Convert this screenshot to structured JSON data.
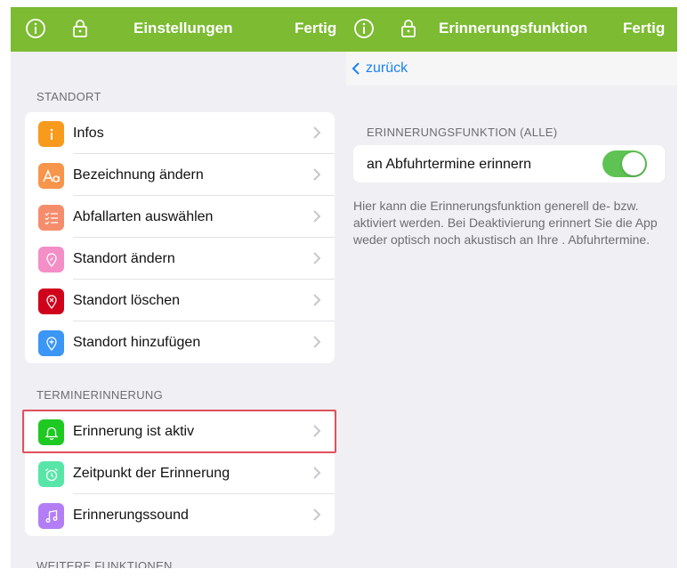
{
  "left": {
    "title": "Einstellungen",
    "done": "Fertig",
    "sections": [
      {
        "header": "STANDORT",
        "items": [
          {
            "label": "Infos",
            "icon": "info-icon",
            "color": "#f89a1c"
          },
          {
            "label": "Bezeichnung ändern",
            "icon": "text-aa-icon",
            "color": "#f7954a"
          },
          {
            "label": "Abfallarten auswählen",
            "icon": "checklist-icon",
            "color": "#f58d6c"
          },
          {
            "label": "Standort ändern",
            "icon": "location-pin-icon",
            "color": "#f38ec6"
          },
          {
            "label": "Standort löschen",
            "icon": "location-delete-icon",
            "color": "#d0021b"
          },
          {
            "label": "Standort hinzufügen",
            "icon": "location-add-icon",
            "color": "#3b96f5"
          }
        ]
      },
      {
        "header": "TERMINERINNERUNG",
        "items": [
          {
            "label": "Erinnerung ist aktiv",
            "icon": "bell-icon",
            "color": "#1ec922"
          },
          {
            "label": "Zeitpunkt der Erinnerung",
            "icon": "alarm-clock-icon",
            "color": "#58e6a8"
          },
          {
            "label": "Erinnerungssound",
            "icon": "music-note-icon",
            "color": "#b37ef5"
          }
        ]
      }
    ],
    "cut_header": "WEITERE FUNKTIONEN"
  },
  "right": {
    "title": "Erinnerungsfunktion",
    "done": "Fertig",
    "back": "zurück",
    "section_header": "ERINNERUNGSFUNKTION (ALLE)",
    "toggle_label": "an Abfuhrtermine erinnern",
    "toggle_on": true,
    "description": "Hier kann die Erinnerungsfunktion generell de- bzw. aktiviert werden. Bei Deaktivierung erinnert Sie die App weder optisch noch akustisch an Ihre                . Abfuhrtermine."
  },
  "colors": {
    "navbar": "#7cbb32",
    "link": "#1a82f5",
    "toggle_on": "#5ec353",
    "highlight": "#e0505d"
  }
}
